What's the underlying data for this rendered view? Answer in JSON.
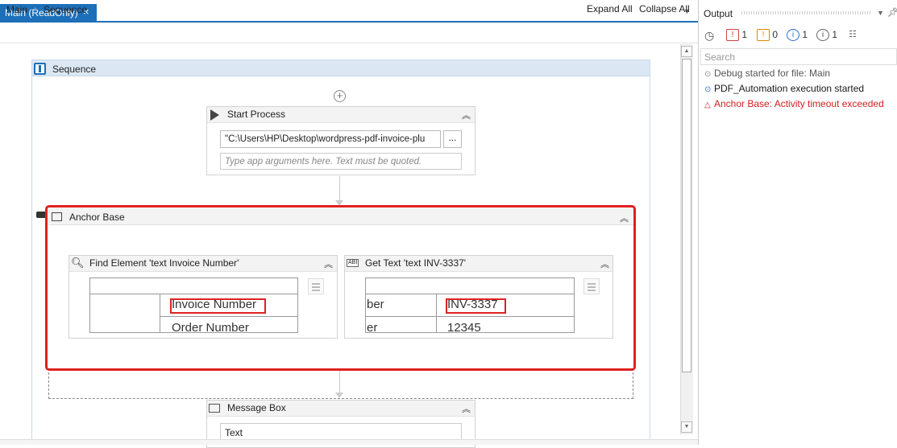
{
  "tab": {
    "title": "Main (ReadOnly)",
    "close": "×"
  },
  "breadcrumb": {
    "items": [
      "Main",
      "Sequence"
    ],
    "separator": ">"
  },
  "toolbar": {
    "expand_all": "Expand All",
    "collapse_all": "Collapse All"
  },
  "sequence": {
    "title": "Sequence"
  },
  "start_process": {
    "title": "Start Process",
    "path_value": "\"C:\\Users\\HP\\Desktop\\wordpress-pdf-invoice-plu",
    "browse_label": "...",
    "args_placeholder": "Type app arguments here. Text must be quoted."
  },
  "anchor_base": {
    "title": "Anchor Base",
    "highlight_color": "#e02020",
    "find_element": {
      "title": "Find Element 'text  Invoice Number'",
      "screenshot": {
        "row1": "Invoice Number",
        "row2": "Order Number"
      }
    },
    "get_text": {
      "title": "Get Text 'text  INV-3337'",
      "icon_text": "ABI",
      "screenshot": {
        "row1_left": "ber",
        "row1_right": "INV-3337",
        "row2_left": "er",
        "row2_right": "12345"
      }
    }
  },
  "message_box": {
    "title": "Message Box",
    "input_value": "Text"
  },
  "output": {
    "title": "Output",
    "counts": {
      "errors": "1",
      "warnings": "0",
      "info": "1",
      "trace": "1"
    },
    "search_placeholder": "Search",
    "logs": [
      {
        "text": "Debug started for file: Main",
        "level": "trace",
        "color": "#555555"
      },
      {
        "text": "PDF_Automation execution started",
        "level": "info",
        "color": "#1a1a1a"
      },
      {
        "text": "Anchor Base: Activity timeout exceeded",
        "level": "error",
        "color": "#d22020"
      }
    ]
  }
}
